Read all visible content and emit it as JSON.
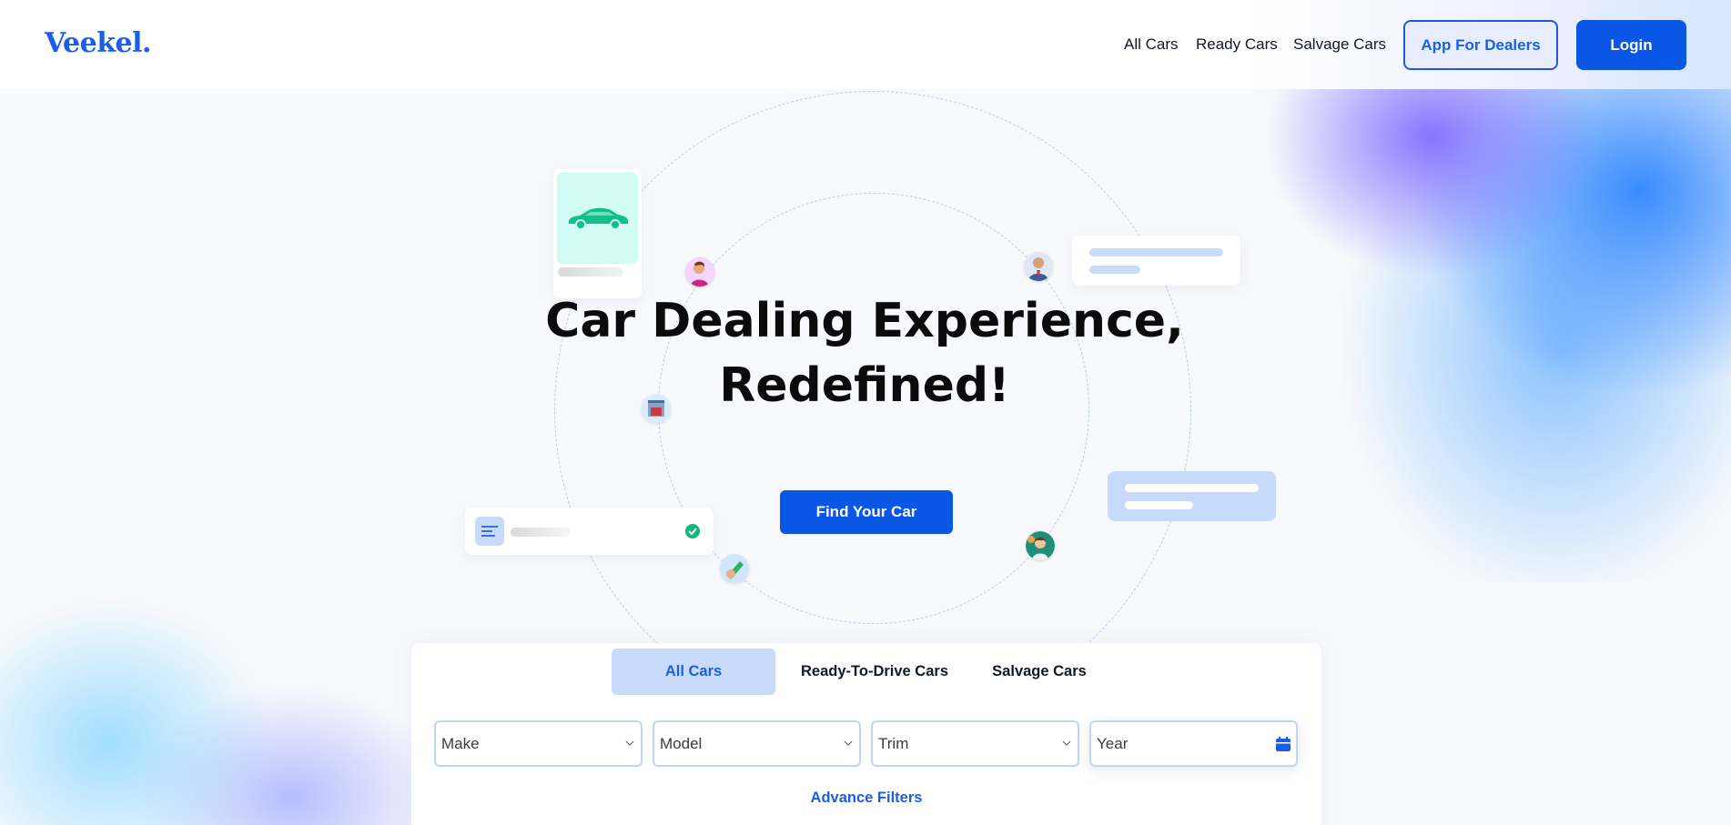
{
  "header": {
    "logo": "Veekel.",
    "nav": [
      {
        "label": "All Cars"
      },
      {
        "label": "Ready Cars"
      },
      {
        "label": "Salvage Cars"
      }
    ],
    "dealers_button": "App For Dealers",
    "login_button": "Login"
  },
  "hero": {
    "title_line1": "Car Dealing Experience,",
    "title_line2": "Redefined!",
    "cta": "Find Your Car"
  },
  "search": {
    "tabs": [
      {
        "label": "All Cars",
        "active": true
      },
      {
        "label": "Ready-To-Drive Cars",
        "active": false
      },
      {
        "label": "Salvage Cars",
        "active": false
      }
    ],
    "fields": {
      "make": "Make",
      "model": "Model",
      "trim": "Trim",
      "year": "Year"
    },
    "advance_filters": "Advance Filters"
  },
  "colors": {
    "brand": "#0a57e6",
    "accent_light": "#c9dbfb",
    "success": "#14b57c"
  },
  "icons": [
    "car-icon",
    "list-icon",
    "check-icon",
    "chevron-down-icon",
    "calendar-icon",
    "avatar"
  ]
}
